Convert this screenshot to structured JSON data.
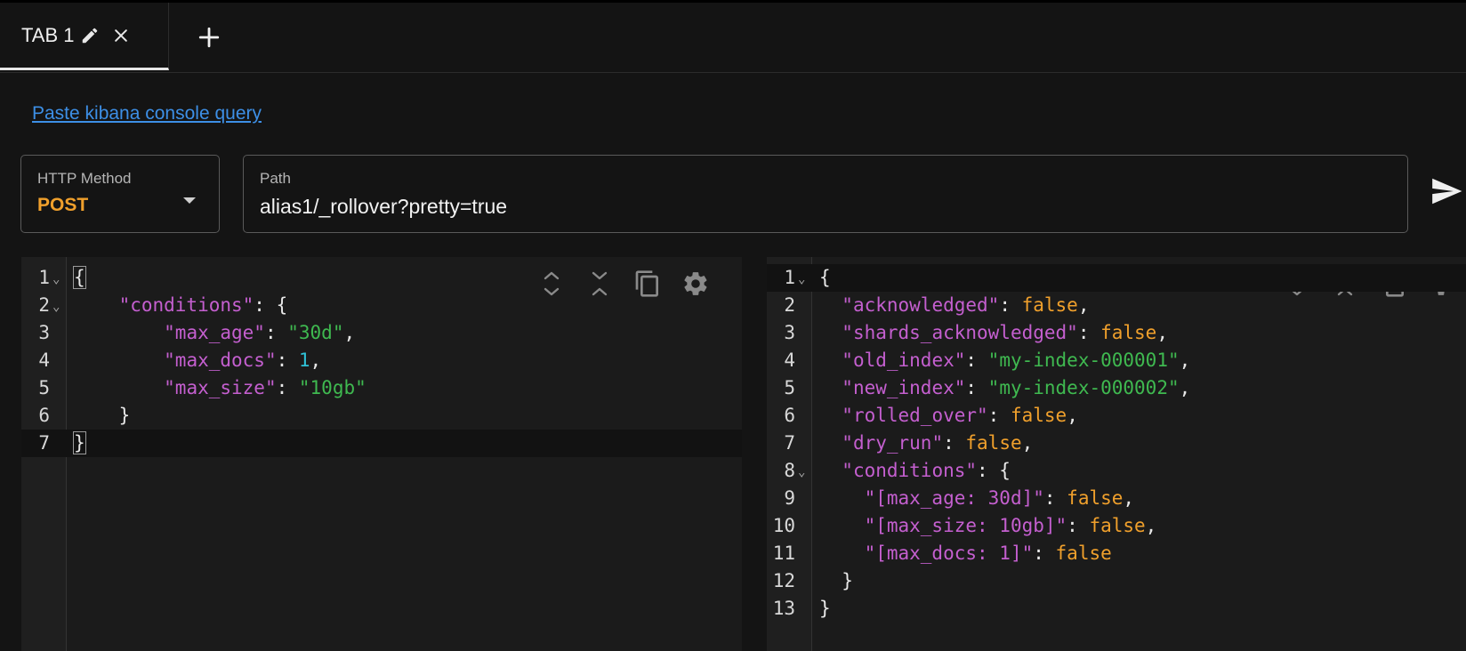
{
  "tabs": [
    {
      "label": "TAB 1"
    }
  ],
  "link": {
    "paste_kibana": "Paste kibana console query"
  },
  "request": {
    "method_label": "HTTP Method",
    "method_value": "POST",
    "path_label": "Path",
    "path_value": "alias1/_rollover?pretty=true"
  },
  "request_body_lines": [
    [
      {
        "t": "{",
        "c": "p"
      }
    ],
    [
      {
        "t": "    ",
        "c": "p"
      },
      {
        "t": "\"conditions\"",
        "c": "k"
      },
      {
        "t": ": {",
        "c": "p"
      }
    ],
    [
      {
        "t": "        ",
        "c": "p"
      },
      {
        "t": "\"max_age\"",
        "c": "k"
      },
      {
        "t": ": ",
        "c": "p"
      },
      {
        "t": "\"30d\"",
        "c": "s"
      },
      {
        "t": ",",
        "c": "p"
      }
    ],
    [
      {
        "t": "        ",
        "c": "p"
      },
      {
        "t": "\"max_docs\"",
        "c": "k"
      },
      {
        "t": ": ",
        "c": "p"
      },
      {
        "t": "1",
        "c": "n"
      },
      {
        "t": ",",
        "c": "p"
      }
    ],
    [
      {
        "t": "        ",
        "c": "p"
      },
      {
        "t": "\"max_size\"",
        "c": "k"
      },
      {
        "t": ": ",
        "c": "p"
      },
      {
        "t": "\"10gb\"",
        "c": "s"
      }
    ],
    [
      {
        "t": "    }",
        "c": "p"
      }
    ],
    [
      {
        "t": "}",
        "c": "p"
      }
    ]
  ],
  "response_body_lines": [
    [
      {
        "t": "{",
        "c": "p"
      }
    ],
    [
      {
        "t": "  ",
        "c": "p"
      },
      {
        "t": "\"acknowledged\"",
        "c": "k"
      },
      {
        "t": ": ",
        "c": "p"
      },
      {
        "t": "false",
        "c": "b"
      },
      {
        "t": ",",
        "c": "p"
      }
    ],
    [
      {
        "t": "  ",
        "c": "p"
      },
      {
        "t": "\"shards_acknowledged\"",
        "c": "k"
      },
      {
        "t": ": ",
        "c": "p"
      },
      {
        "t": "false",
        "c": "b"
      },
      {
        "t": ",",
        "c": "p"
      }
    ],
    [
      {
        "t": "  ",
        "c": "p"
      },
      {
        "t": "\"old_index\"",
        "c": "k"
      },
      {
        "t": ": ",
        "c": "p"
      },
      {
        "t": "\"my-index-000001\"",
        "c": "s"
      },
      {
        "t": ",",
        "c": "p"
      }
    ],
    [
      {
        "t": "  ",
        "c": "p"
      },
      {
        "t": "\"new_index\"",
        "c": "k"
      },
      {
        "t": ": ",
        "c": "p"
      },
      {
        "t": "\"my-index-000002\"",
        "c": "s"
      },
      {
        "t": ",",
        "c": "p"
      }
    ],
    [
      {
        "t": "  ",
        "c": "p"
      },
      {
        "t": "\"rolled_over\"",
        "c": "k"
      },
      {
        "t": ": ",
        "c": "p"
      },
      {
        "t": "false",
        "c": "b"
      },
      {
        "t": ",",
        "c": "p"
      }
    ],
    [
      {
        "t": "  ",
        "c": "p"
      },
      {
        "t": "\"dry_run\"",
        "c": "k"
      },
      {
        "t": ": ",
        "c": "p"
      },
      {
        "t": "false",
        "c": "b"
      },
      {
        "t": ",",
        "c": "p"
      }
    ],
    [
      {
        "t": "  ",
        "c": "p"
      },
      {
        "t": "\"conditions\"",
        "c": "k"
      },
      {
        "t": ": {",
        "c": "p"
      }
    ],
    [
      {
        "t": "    ",
        "c": "p"
      },
      {
        "t": "\"[max_age: 30d]\"",
        "c": "k"
      },
      {
        "t": ": ",
        "c": "p"
      },
      {
        "t": "false",
        "c": "b"
      },
      {
        "t": ",",
        "c": "p"
      }
    ],
    [
      {
        "t": "    ",
        "c": "p"
      },
      {
        "t": "\"[max_size: 10gb]\"",
        "c": "k"
      },
      {
        "t": ": ",
        "c": "p"
      },
      {
        "t": "false",
        "c": "b"
      },
      {
        "t": ",",
        "c": "p"
      }
    ],
    [
      {
        "t": "    ",
        "c": "p"
      },
      {
        "t": "\"[max_docs: 1]\"",
        "c": "k"
      },
      {
        "t": ": ",
        "c": "p"
      },
      {
        "t": "false",
        "c": "b"
      }
    ],
    [
      {
        "t": "  }",
        "c": "p"
      }
    ],
    [
      {
        "t": "}",
        "c": "p"
      }
    ]
  ],
  "request_fold_lines": [
    1,
    2
  ],
  "response_fold_lines": [
    1,
    8
  ],
  "colors": {
    "accent_method": "#f0a02c",
    "link": "#3d8fe6",
    "json_key": "#c45fcf",
    "json_string": "#3fb950",
    "json_bool": "#f0a02c",
    "json_number": "#2fc1d6"
  },
  "icons": {
    "tab_edit": "pencil-icon",
    "tab_close": "close-icon",
    "add_tab": "plus-icon",
    "method_dropdown": "caret-down-icon",
    "send": "send-icon",
    "expand": "expand-icon",
    "collapse": "collapse-icon",
    "copy": "copy-icon",
    "settings": "gear-icon"
  }
}
